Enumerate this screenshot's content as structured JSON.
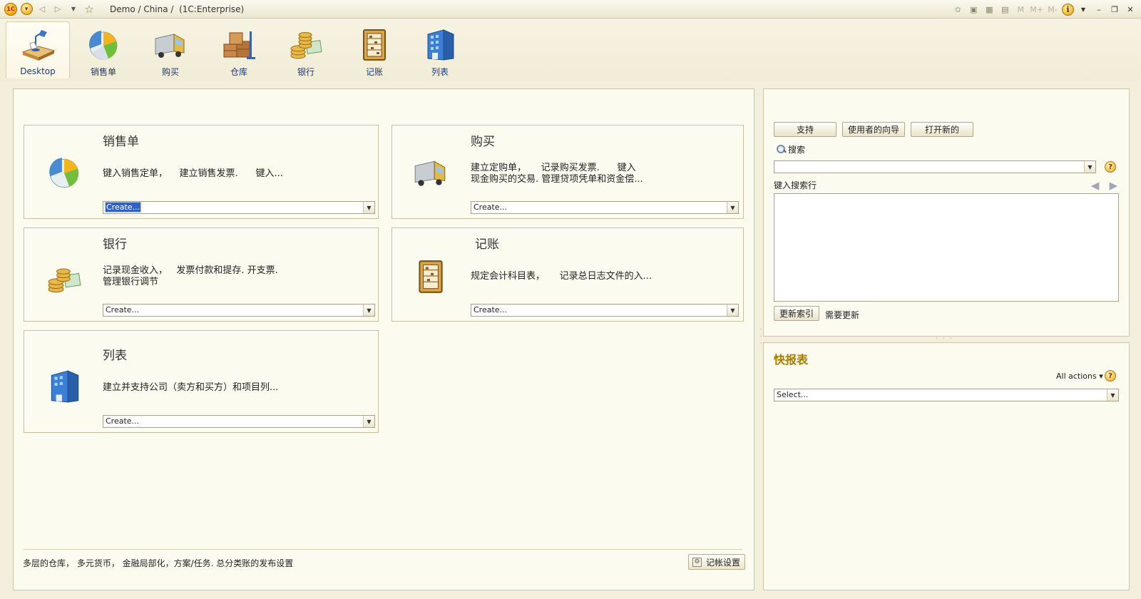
{
  "window": {
    "title": "Demo / China /  (1C:Enterprise)"
  },
  "titlebar": {
    "logo_text": "1C",
    "right_m": "M",
    "right_mplus": "M+",
    "right_mminus": "M-",
    "info": "i"
  },
  "sections": [
    {
      "label": "Desktop",
      "icon": "desk-lamp-icon"
    },
    {
      "label": "销售单",
      "icon": "pie-chart-icon"
    },
    {
      "label": "购买",
      "icon": "truck-icon"
    },
    {
      "label": "仓库",
      "icon": "boxes-icon"
    },
    {
      "label": "银行",
      "icon": "coins-icon"
    },
    {
      "label": "记账",
      "icon": "abacus-icon"
    },
    {
      "label": "列表",
      "icon": "building-icon"
    }
  ],
  "cards": [
    {
      "title": "销售单",
      "desc": "键入销售定单，    建立销售发票.      键入...",
      "combo": "Create...",
      "selected": true
    },
    {
      "title": "购买",
      "desc": "建立定购单，     记录购买发票.      键入\n现金购买的交易. 管理贷项凭单和资金偿...",
      "combo": "Create..."
    },
    {
      "title": "银行",
      "desc": "记录现金收入，   发票付款和提存. 开支票.\n管理银行调节",
      "combo": "Create..."
    },
    {
      "title": "记账",
      "desc": "规定会计科目表，     记录总日志文件的入...",
      "combo": "Create..."
    },
    {
      "title": "列表",
      "desc": "建立并支持公司（卖方和买方）和项目列...",
      "combo": "Create..."
    }
  ],
  "footer": {
    "text": "多层的仓库，  多元货币，  金融局部化，方案/任务. 总分类账的发布设置",
    "settings_button": "记帐设置"
  },
  "search_panel": {
    "buttons": [
      "支持",
      "使用者的向导",
      "打开新的"
    ],
    "search_label": "搜索",
    "search_value": "",
    "hint": "键入搜索行",
    "update_button": "更新索引",
    "needs_update": "需要更新",
    "help": "?"
  },
  "reports_panel": {
    "title": "快报表",
    "all_actions": "All actions ▾",
    "select_value": "Select...",
    "help": "?"
  },
  "colors": {
    "link_blue": "#1a3a7a",
    "report_title": "#a67c00",
    "selection": "#3162c8"
  }
}
